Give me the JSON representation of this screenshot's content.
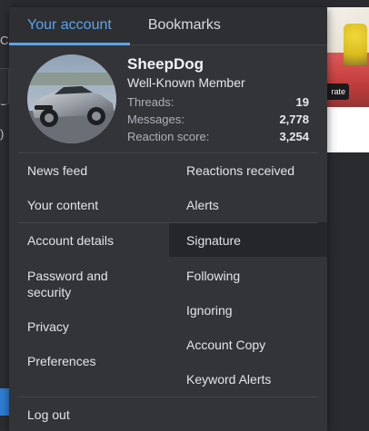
{
  "tabs": [
    {
      "label": "Your account",
      "active": true
    },
    {
      "label": "Bookmarks",
      "active": false
    }
  ],
  "profile": {
    "username": "SheepDog",
    "member_title": "Well-Known Member",
    "stats": [
      {
        "label": "Threads:",
        "value": "19"
      },
      {
        "label": "Messages:",
        "value": "2,778"
      },
      {
        "label": "Reaction score:",
        "value": "3,254"
      }
    ],
    "avatar_icon": "car-avatar-icon"
  },
  "links_left": [
    "News feed",
    "Your content",
    "Account details",
    "Password and security",
    "Privacy",
    "Preferences"
  ],
  "links_right": [
    "Reactions received",
    "Alerts",
    "Signature",
    "Following",
    "Ignoring",
    "Account Copy",
    "Keyword Alerts"
  ],
  "logout_label": "Log out",
  "background": {
    "rate_button_label": "rate",
    "left_fragments": [
      "C",
      "u",
      ")"
    ]
  },
  "colors": {
    "accent": "#5ba4ea",
    "panel": "#333438",
    "highlight_row": "#25262a"
  }
}
